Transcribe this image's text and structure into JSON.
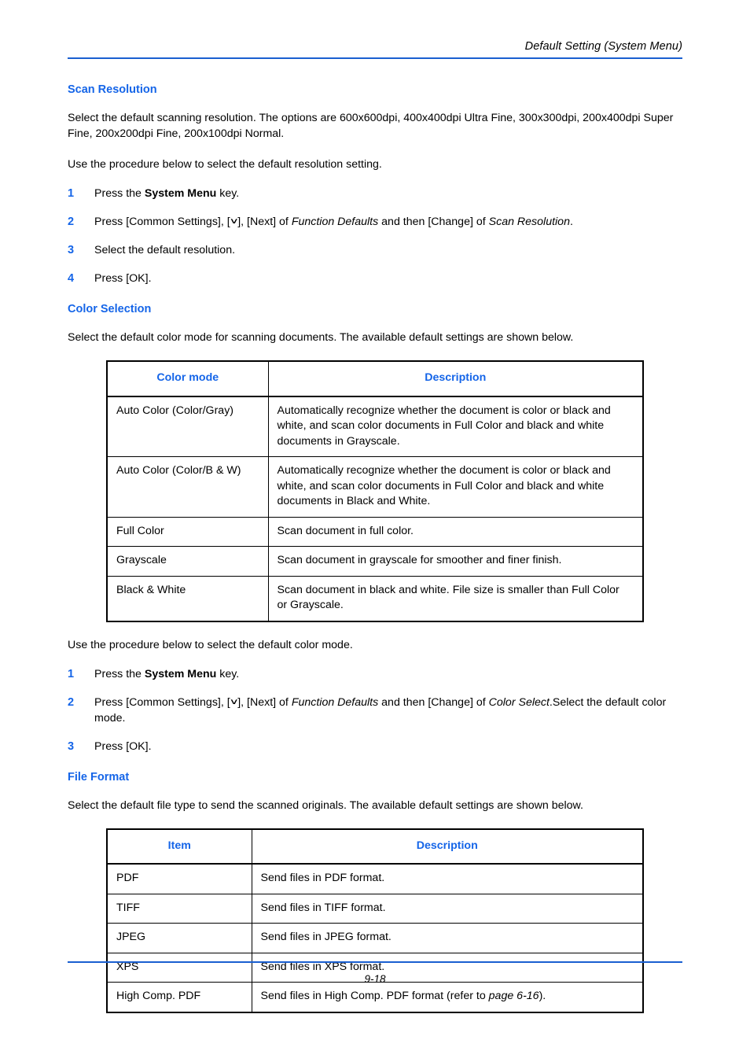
{
  "header": {
    "title": "Default Setting (System Menu)"
  },
  "footer": {
    "page_number": "9-18"
  },
  "colors": {
    "heading_blue": "#1565e8",
    "rule_blue": "#1a5fd0",
    "text_black": "#000000"
  },
  "sections": {
    "scan_resolution": {
      "heading": "Scan Resolution",
      "intro": "Select the default scanning resolution. The options are 600x600dpi, 400x400dpi Ultra Fine, 300x300dpi, 200x400dpi Super Fine, 200x200dpi Fine, 200x100dpi Normal.",
      "procedure_lead": "Use the procedure below to select the default resolution setting.",
      "steps": [
        {
          "number": "1",
          "parts": [
            {
              "text": "Press the ",
              "style": "normal"
            },
            {
              "text": "System Menu",
              "style": "bold"
            },
            {
              "text": " key.",
              "style": "normal"
            }
          ]
        },
        {
          "number": "2",
          "parts": [
            {
              "text": "Press [Common Settings], [",
              "style": "normal"
            },
            {
              "text": "∨",
              "style": "chevron"
            },
            {
              "text": "], [Next] of ",
              "style": "normal"
            },
            {
              "text": "Function Defaults",
              "style": "italic"
            },
            {
              "text": " and then [Change] of ",
              "style": "normal"
            },
            {
              "text": "Scan Resolution",
              "style": "italic"
            },
            {
              "text": ".",
              "style": "normal"
            }
          ]
        },
        {
          "number": "3",
          "parts": [
            {
              "text": "Select the default resolution.",
              "style": "normal"
            }
          ]
        },
        {
          "number": "4",
          "parts": [
            {
              "text": "Press [OK].",
              "style": "normal"
            }
          ]
        }
      ]
    },
    "color_selection": {
      "heading": "Color Selection",
      "intro": "Select the default color mode for scanning documents. The available default settings are shown below.",
      "table": {
        "headers": [
          "Color mode",
          "Description"
        ],
        "rows": [
          {
            "item": "Auto Color (Color/Gray)",
            "description": "Automatically recognize whether the document is color or black and white, and scan color documents in Full Color and black and white documents in Grayscale."
          },
          {
            "item": "Auto Color (Color/B & W)",
            "description": "Automatically recognize whether the document is color or black and white, and scan color documents in Full Color and black and white documents in Black and White."
          },
          {
            "item": "Full Color",
            "description": "Scan document in full color."
          },
          {
            "item": "Grayscale",
            "description": "Scan document in grayscale for smoother and finer finish."
          },
          {
            "item": "Black & White",
            "description": "Scan document in black and white. File size is smaller than Full Color or Grayscale."
          }
        ]
      },
      "procedure_lead": "Use the procedure below to select the default color mode.",
      "steps": [
        {
          "number": "1",
          "parts": [
            {
              "text": "Press the ",
              "style": "normal"
            },
            {
              "text": "System Menu",
              "style": "bold"
            },
            {
              "text": " key.",
              "style": "normal"
            }
          ]
        },
        {
          "number": "2",
          "parts": [
            {
              "text": "Press [Common Settings], [",
              "style": "normal"
            },
            {
              "text": "∨",
              "style": "chevron"
            },
            {
              "text": "], [Next] of ",
              "style": "normal"
            },
            {
              "text": "Function Defaults",
              "style": "italic"
            },
            {
              "text": " and then [Change] of ",
              "style": "normal"
            },
            {
              "text": "Color Select",
              "style": "italic"
            },
            {
              "text": ".Select the default color mode.",
              "style": "normal"
            }
          ]
        },
        {
          "number": "3",
          "parts": [
            {
              "text": "Press [OK].",
              "style": "normal"
            }
          ]
        }
      ]
    },
    "file_format": {
      "heading": "File Format",
      "intro": "Select the default file type to send the scanned originals. The available default settings are shown below.",
      "table": {
        "headers": [
          "Item",
          "Description"
        ],
        "rows": [
          {
            "item": "PDF",
            "parts": [
              {
                "text": "Send files in PDF format.",
                "style": "normal"
              }
            ]
          },
          {
            "item": "TIFF",
            "parts": [
              {
                "text": "Send files in TIFF format.",
                "style": "normal"
              }
            ]
          },
          {
            "item": "JPEG",
            "parts": [
              {
                "text": "Send files in JPEG format.",
                "style": "normal"
              }
            ]
          },
          {
            "item": "XPS",
            "parts": [
              {
                "text": "Send files in XPS format.",
                "style": "normal"
              }
            ]
          },
          {
            "item": "High Comp. PDF",
            "parts": [
              {
                "text": "Send files in High Comp. PDF format (refer to ",
                "style": "normal"
              },
              {
                "text": "page 6-16",
                "style": "italic"
              },
              {
                "text": ").",
                "style": "normal"
              }
            ]
          }
        ]
      }
    }
  }
}
